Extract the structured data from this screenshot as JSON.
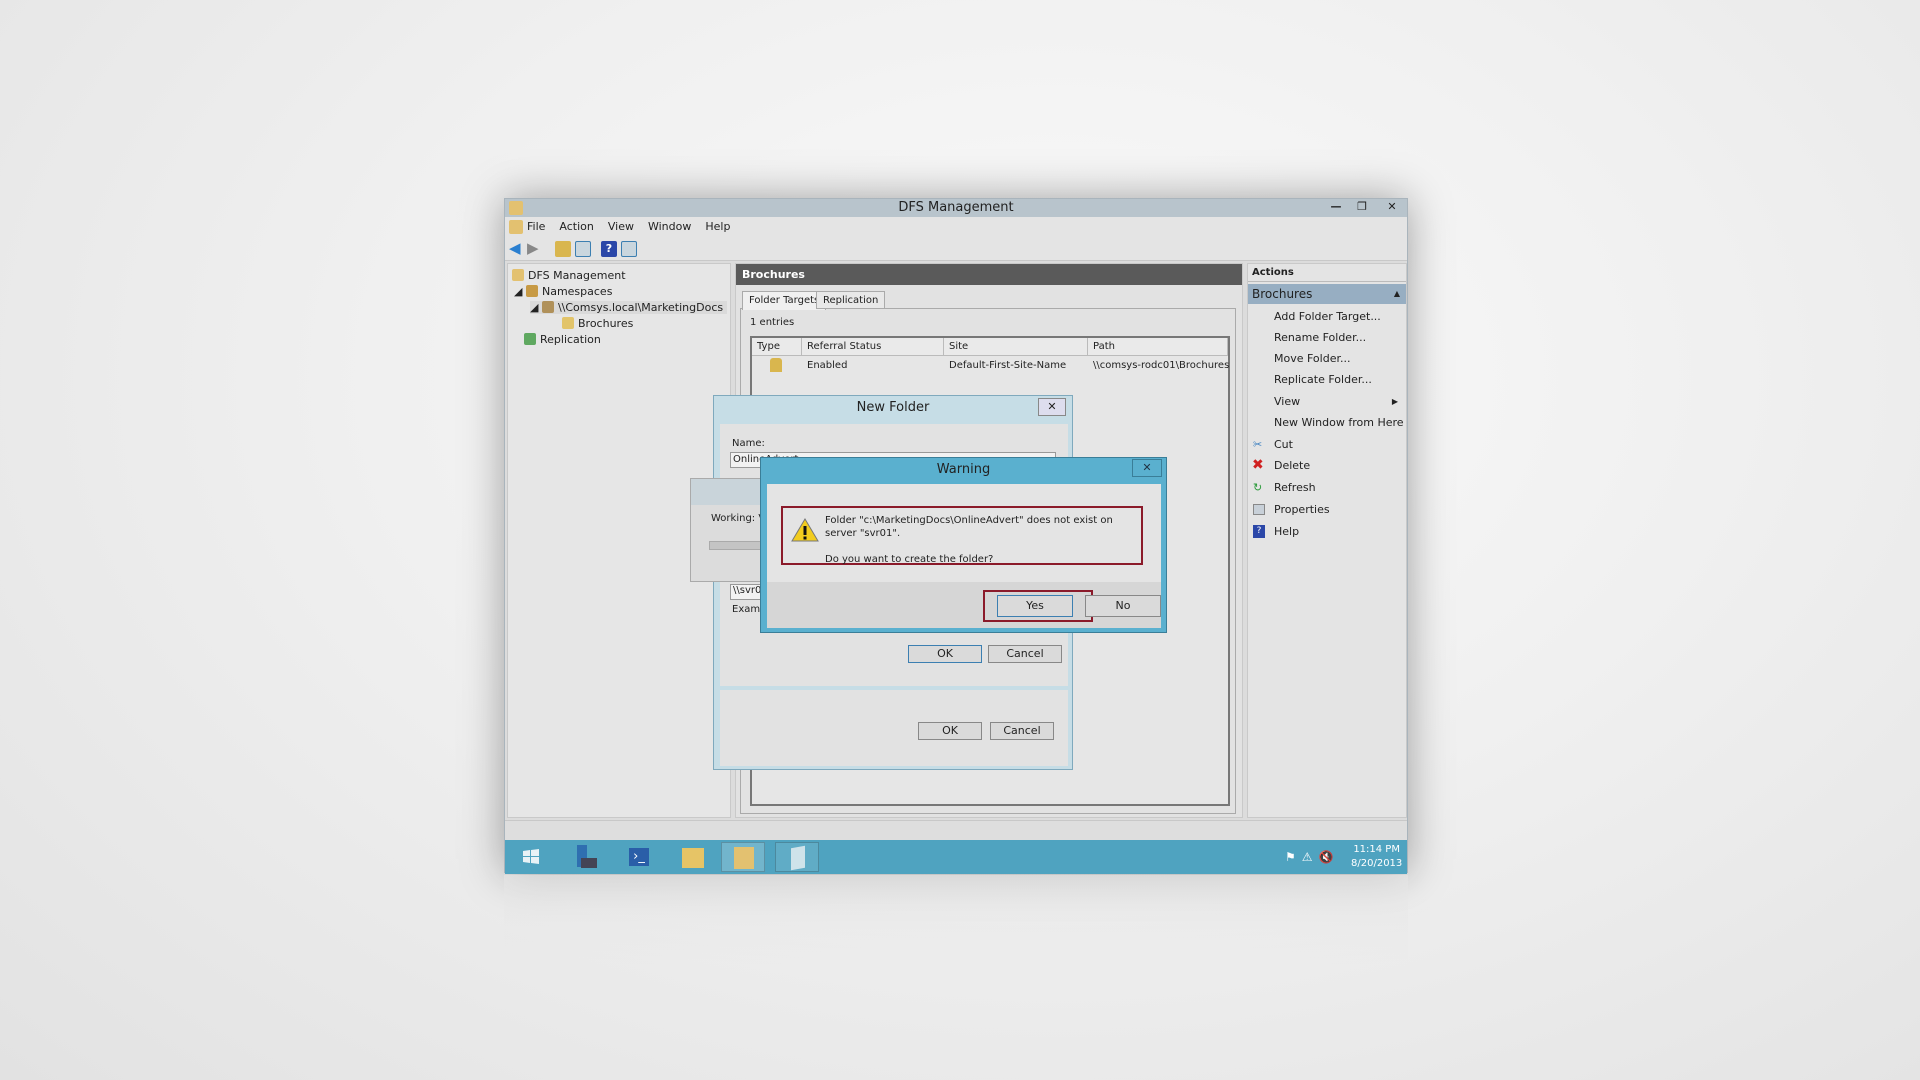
{
  "window": {
    "title": "DFS Management"
  },
  "menu": [
    "File",
    "Action",
    "View",
    "Window",
    "Help"
  ],
  "tree": {
    "root": "DFS Management",
    "namespaces": "Namespaces",
    "namespace": "\\\\Comsys.local\\MarketingDocs",
    "folder": "Brochures",
    "replication": "Replication"
  },
  "main": {
    "header": "Brochures",
    "tabs": [
      "Folder Targets",
      "Replication"
    ],
    "entries": "1 entries",
    "columns": [
      "Type",
      "Referral Status",
      "Site",
      "Path"
    ],
    "rows": [
      {
        "status": "Enabled",
        "site": "Default-First-Site-Name",
        "path": "\\\\comsys-rodc01\\Brochures"
      }
    ]
  },
  "actions": {
    "title": "Actions",
    "section": "Brochures",
    "items": [
      "Add Folder Target...",
      "Rename Folder...",
      "Move Folder...",
      "Replicate Folder...",
      "View",
      "New Window from Here",
      "Cut",
      "Delete",
      "Refresh",
      "Properties",
      "Help"
    ]
  },
  "new_folder": {
    "title": "New Folder",
    "name_label": "Name:",
    "name_value": "OnlineAdvert",
    "path_value": "\\\\svr0",
    "example_label": "Examp",
    "ok": "OK",
    "cancel": "Cancel"
  },
  "working": {
    "text": "Working: Va"
  },
  "warning": {
    "title": "Warning",
    "message": "Folder \"c:\\MarketingDocs\\OnlineAdvert\" does not exist on server \"svr01\".",
    "question": "Do you want to create the folder?",
    "yes": "Yes",
    "no": "No"
  },
  "taskbar": {
    "time": "11:14 PM",
    "date": "8/20/2013"
  },
  "colors": {
    "taskbar": "#4fa3c0",
    "dialog_frame": "#5ab0cf",
    "highlight": "#8b1a2a"
  }
}
